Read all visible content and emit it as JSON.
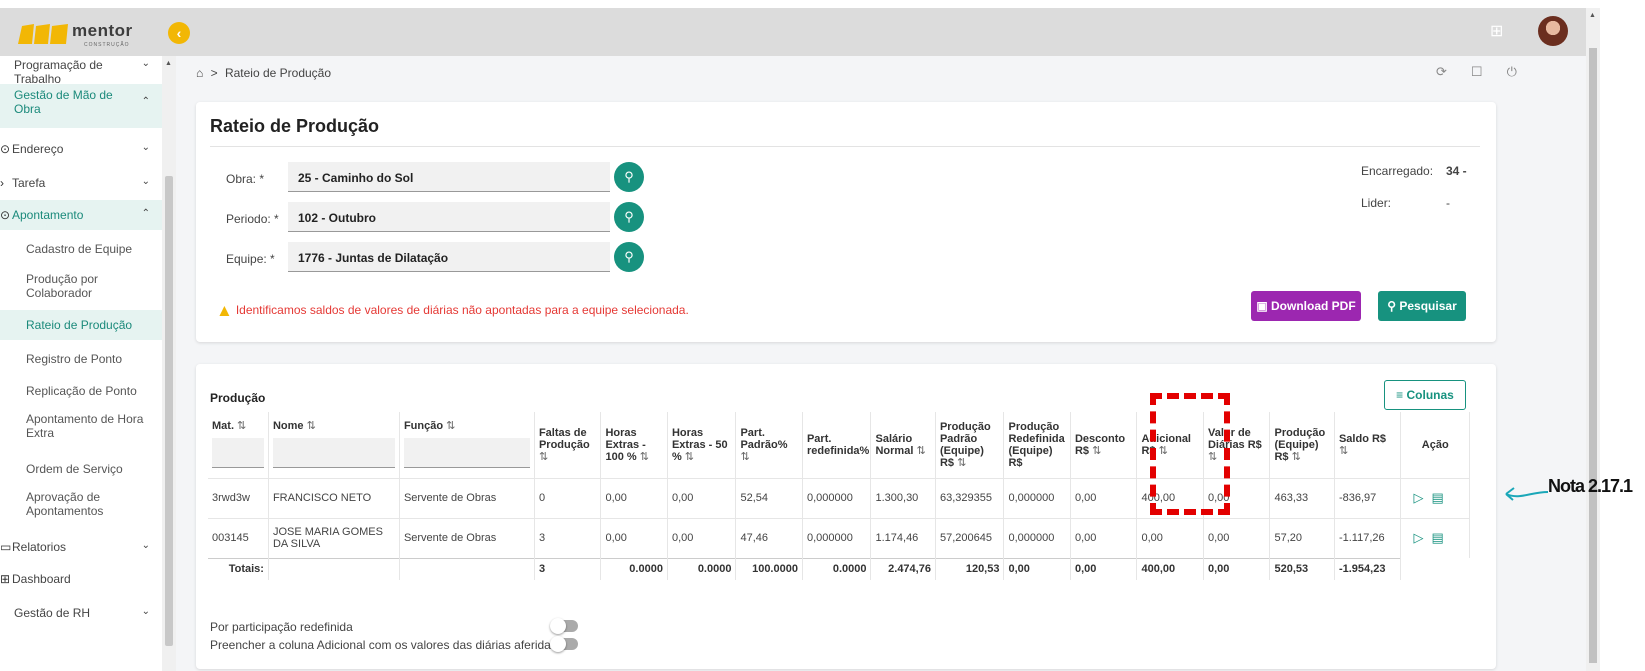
{
  "brand": {
    "name": "mentor",
    "sub": "CONSTRUÇÃO"
  },
  "sidebar": {
    "items": [
      {
        "label": "Programação de Trabalho",
        "chev": "⌄"
      },
      {
        "label": "Gestão de Mão de Obra",
        "chev": "⌃"
      },
      {
        "label": "Endereço",
        "chev": "⌄"
      },
      {
        "label": "Tarefa",
        "chev": "⌄"
      },
      {
        "label": "Apontamento",
        "chev": "⌃"
      },
      {
        "label": "Cadastro de Equipe"
      },
      {
        "label": "Produção por Colaborador"
      },
      {
        "label": "Rateio de Produção"
      },
      {
        "label": "Registro de Ponto"
      },
      {
        "label": "Replicação de Ponto"
      },
      {
        "label": "Apontamento de Hora Extra"
      },
      {
        "label": "Ordem de Serviço"
      },
      {
        "label": "Aprovação de Apontamentos"
      },
      {
        "label": "Relatorios",
        "chev": "⌄"
      },
      {
        "label": "Dashboard"
      },
      {
        "label": "Gestão de RH",
        "chev": "⌄"
      }
    ]
  },
  "breadcrumb": {
    "home": "⌂",
    "sep": ">",
    "current": "Rateio de Produção"
  },
  "form": {
    "title": "Rateio de Produção",
    "obra_label": "Obra: *",
    "obra_value": "25 - Caminho do Sol",
    "periodo_label": "Periodo: *",
    "periodo_value": "102 - Outubro",
    "equipe_label": "Equipe: *",
    "equipe_value": "1776 - Juntas de Dilatação",
    "encarregado_label": "Encarregado:",
    "encarregado_value": "34 -",
    "lider_label": "Lider:",
    "lider_value": "-",
    "warning": "Identificamos saldos de valores de diárias não apontadas para a equipe selecionada.",
    "download_label": "Download PDF",
    "pesquisar_label": "Pesquisar"
  },
  "table": {
    "title": "Produção",
    "colunas_label": "Colunas",
    "headers": [
      "Mat.",
      "Nome",
      "Função",
      "Faltas de Produção",
      "Horas Extras - 100 %",
      "Horas Extras - 50 %",
      "Part. Padrão%",
      "Part. redefinida%",
      "Salário Normal",
      "Produção Padrão (Equipe) R$",
      "Produção Redefinida (Equipe) R$",
      "Desconto R$",
      "Adicional R$",
      "Valor de Diárias R$",
      "Produção (Equipe) R$",
      "Saldo R$",
      "Ação"
    ],
    "rows": [
      [
        "3rwd3w",
        "FRANCISCO NETO",
        "Servente de Obras",
        "0",
        "0,00",
        "0,00",
        "52,54",
        "0,000000",
        "1.300,30",
        "63,329355",
        "0,000000",
        "0,00",
        "400,00",
        "0,00",
        "463,33",
        "-836,97"
      ],
      [
        "003145",
        "JOSE MARIA GOMES DA SILVA",
        "Servente de Obras",
        "3",
        "0,00",
        "0,00",
        "47,46",
        "0,000000",
        "1.174,46",
        "57,200645",
        "0,000000",
        "0,00",
        "0,00",
        "0,00",
        "57,20",
        "-1.117,26"
      ]
    ],
    "totals_label": "Totais:",
    "totals": [
      "3",
      "0.0000",
      "0.0000",
      "100.0000",
      "0.0000",
      "2.474,76",
      "120,53",
      "0,00",
      "0,00",
      "400,00",
      "0,00",
      "520,53",
      "-1.954,23"
    ],
    "toggle1": "Por participação redefinida",
    "toggle2": "Preencher a coluna Adicional com os valores das diárias aferidas"
  },
  "annotation": {
    "note": "Nota 2.17.1",
    "color": "#e30000",
    "arrow_color": "#1aa7b8"
  }
}
